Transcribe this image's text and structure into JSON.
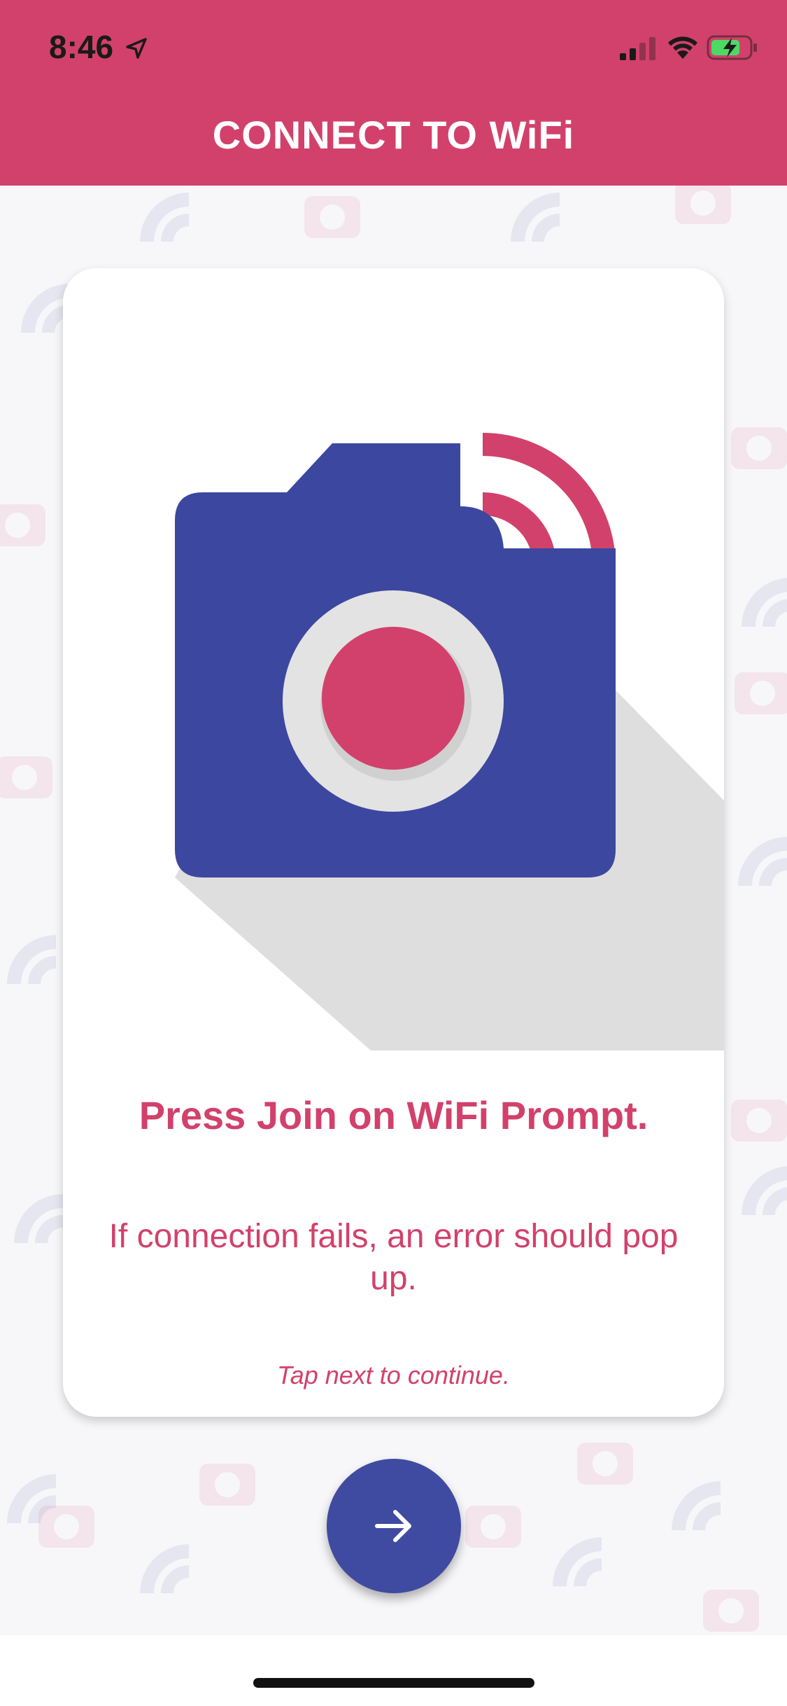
{
  "status_bar": {
    "time": "8:46",
    "location_icon": "location-arrow-icon",
    "signal_icon": "cellular-signal-icon",
    "wifi_icon": "wifi-icon",
    "battery_icon": "battery-charging-icon"
  },
  "header": {
    "title": "CONNECT TO WiFi",
    "background_color": "#d2416b"
  },
  "card": {
    "illustration_icon": "wifi-camera-icon",
    "heading": "Press Join on WiFi Prompt.",
    "body": "If connection fails, an error should pop up.",
    "hint": "Tap next to continue."
  },
  "next_button": {
    "icon": "arrow-right-icon",
    "color": "#3f4ba0"
  },
  "colors": {
    "accent": "#d2416b",
    "primary": "#3f4ba0"
  }
}
